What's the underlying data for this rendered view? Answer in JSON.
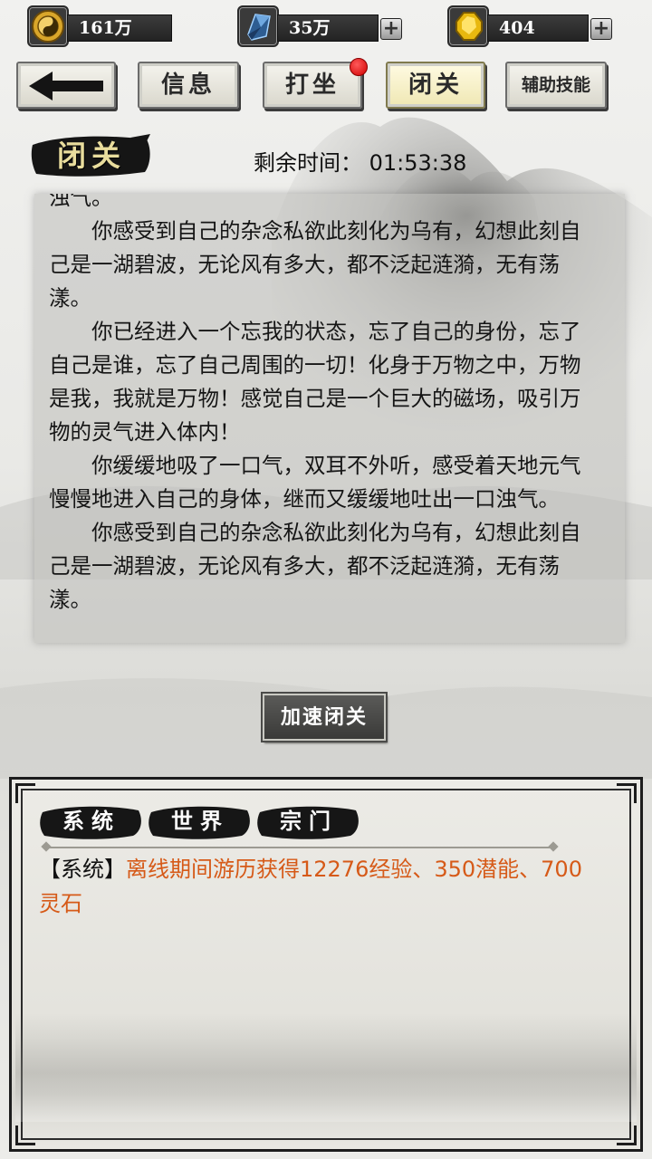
{
  "resources": [
    {
      "name": "coins",
      "value": "161万",
      "icon": "taiji-coin-icon",
      "has_plus": false
    },
    {
      "name": "crystal",
      "value": "35万",
      "icon": "blue-crystal-icon",
      "has_plus": true
    },
    {
      "name": "gem",
      "value": "404",
      "icon": "gold-gem-icon",
      "has_plus": true
    }
  ],
  "nav": {
    "back_icon": "back-arrow-icon",
    "info_label": "信息",
    "meditate_label": "打坐",
    "seclusion_label": "闭关",
    "skill_label": "辅助技能",
    "active": "seclusion",
    "notification_dot_color": "#e00000"
  },
  "section": {
    "title": "闭关",
    "timer_label": "剩余时间：",
    "timer_value": "01:53:38"
  },
  "story": {
    "top_fragment": "浊气。",
    "paragraphs": [
      "你感受到自己的杂念私欲此刻化为乌有，幻想此刻自己是一湖碧波，无论风有多大，都不泛起涟漪，无有荡漾。",
      "你已经进入一个忘我的状态，忘了自己的身份，忘了自己是谁，忘了自己周围的一切！化身于万物之中，万物是我，我就是万物！感觉自己是一个巨大的磁场，吸引万物的灵气进入体内！",
      "你缓缓地吸了一口气，双耳不外听，感受着天地元气慢慢地进入自己的身体，继而又缓缓地吐出一口浊气。",
      "你感受到自己的杂念私欲此刻化为乌有，幻想此刻自己是一湖碧波，无论风有多大，都不泛起涟漪，无有荡漾。"
    ]
  },
  "speed_button": {
    "label": "加速闭关"
  },
  "chat": {
    "tabs": [
      {
        "label": "系统",
        "color": "#111111"
      },
      {
        "label": "世界",
        "color": "#111111"
      },
      {
        "label": "宗门",
        "color": "#111111"
      }
    ],
    "messages": [
      {
        "tag": "【系统】",
        "text": "离线期间游历获得12276经验、350潜能、700灵石",
        "color": "#d65a18"
      }
    ]
  }
}
